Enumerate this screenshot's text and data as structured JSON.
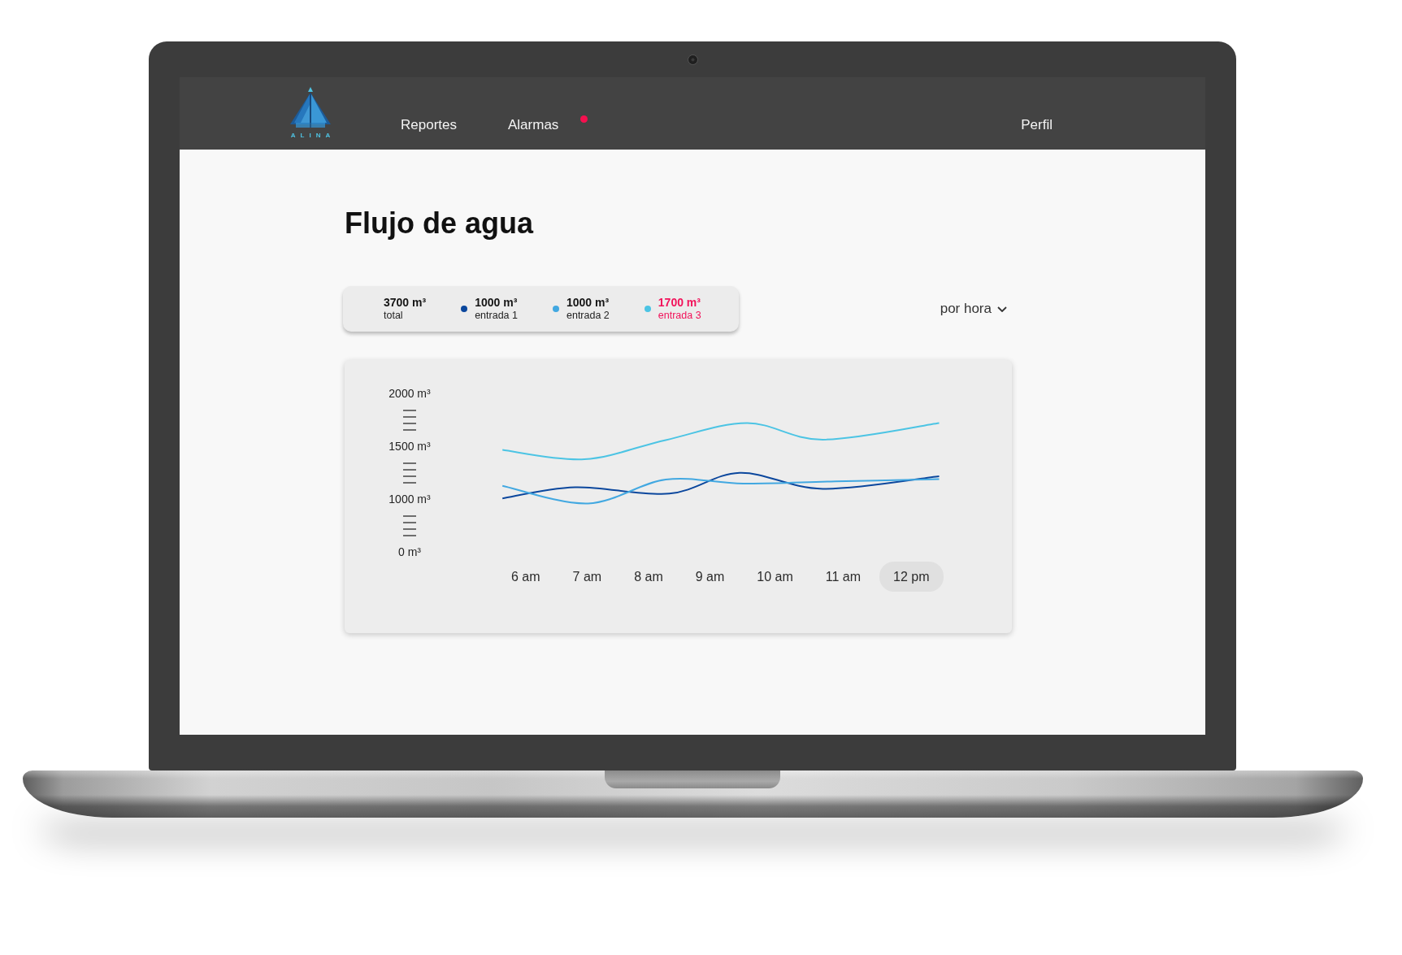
{
  "nav": {
    "logo_wordmark": "ALINA",
    "links": [
      {
        "label": "Reportes",
        "alert": false
      },
      {
        "label": "Alarmas",
        "alert": true
      }
    ],
    "profile": "Perfil"
  },
  "title": "Flujo de agua",
  "summary": [
    {
      "kind": "total",
      "value": "3700 m³",
      "label": "total",
      "alert": false
    },
    {
      "kind": "inlet",
      "value": "1000 m³",
      "label": "entrada 1",
      "color": "#0b479d",
      "alert": false
    },
    {
      "kind": "inlet",
      "value": "1000 m³",
      "label": "entrada 2",
      "color": "#42a8e1",
      "alert": false
    },
    {
      "kind": "inlet",
      "value": "1700 m³",
      "label": "entrada 3",
      "color": "#4cc4e4",
      "alert": true
    }
  ],
  "period_dropdown": {
    "value": "por hora"
  },
  "chart": {
    "y_labels": [
      "2000 m³",
      "1500 m³",
      "1000 m³",
      "0 m³"
    ],
    "lines": [
      {
        "color": "#0b479d"
      },
      {
        "color": "#42a8e1"
      },
      {
        "color": "#4cc4e4"
      }
    ],
    "hours": [
      {
        "label": "6 am",
        "selected": false
      },
      {
        "label": "7 am",
        "selected": false
      },
      {
        "label": "8 am",
        "selected": false
      },
      {
        "label": "9 am",
        "selected": false
      },
      {
        "label": "10 am",
        "selected": false
      },
      {
        "label": "11 am",
        "selected": false
      },
      {
        "label": "12 pm",
        "selected": true
      }
    ]
  }
}
